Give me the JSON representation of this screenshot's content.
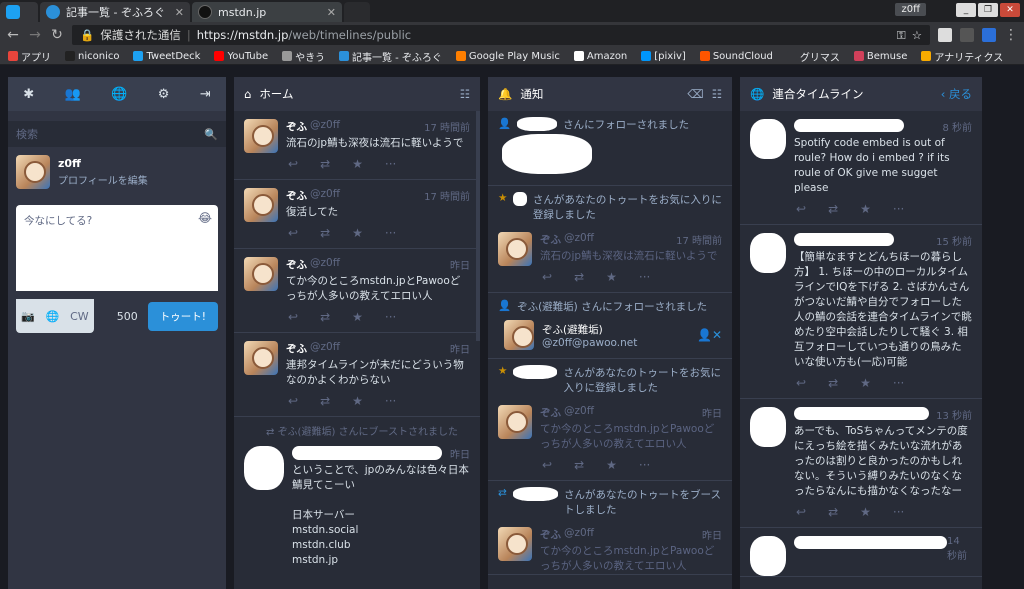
{
  "browser": {
    "tabs": [
      {
        "title": "",
        "icon": "twitter-icon"
      },
      {
        "title": "記事一覧 - ぞふろぐ",
        "icon": "blog-icon"
      },
      {
        "title": "mstdn.jp",
        "icon": "mastodon-icon"
      }
    ],
    "user_chip": "z0ff",
    "secure_label": "保護された通信",
    "url_host": "https://mstdn.jp",
    "url_path": "/web/timelines/public",
    "bookmarks": [
      {
        "label": "アプリ",
        "color": "#e8453c"
      },
      {
        "label": "niconico",
        "color": "#222222"
      },
      {
        "label": "TweetDeck",
        "color": "#1da1f2"
      },
      {
        "label": "YouTube",
        "color": "#ff0000"
      },
      {
        "label": "やきう",
        "color": "#999999"
      },
      {
        "label": "記事一覧 - ぞふろぐ",
        "color": "#2b90d9"
      },
      {
        "label": "Google Play Music",
        "color": "#ff7f00"
      },
      {
        "label": "Amazon",
        "color": "#ffffff"
      },
      {
        "label": "[pixiv]",
        "color": "#0096fa"
      },
      {
        "label": "SoundCloud",
        "color": "#ff5500"
      },
      {
        "label": "グリマス",
        "color": "#35363a"
      },
      {
        "label": "Bemuse",
        "color": "#d0405a"
      },
      {
        "label": "アナリティクス",
        "color": "#f9ab00"
      }
    ]
  },
  "compose": {
    "search_placeholder": "検索",
    "profile_name": "z0ff",
    "profile_edit": "プロフィールを編集",
    "textarea_placeholder": "今なにしてる?",
    "cw_label": "CW",
    "char_count": "500",
    "toot_label": "トゥート!"
  },
  "home": {
    "title": "ホーム",
    "statuses": [
      {
        "name": "ぞふ",
        "acct": "@z0ff",
        "time": "17 時間前",
        "text": "流石のjp鯖も深夜は流石に軽いようで"
      },
      {
        "name": "ぞふ",
        "acct": "@z0ff",
        "time": "17 時間前",
        "text": "復活してた"
      },
      {
        "name": "ぞふ",
        "acct": "@z0ff",
        "time": "昨日",
        "text": "てか今のところmstdn.jpとPawooどっちが人多いの教えてエロい人"
      },
      {
        "name": "ぞふ",
        "acct": "@z0ff",
        "time": "昨日",
        "text": "連邦タイムラインが未だにどういう物なのかよくわからない"
      }
    ],
    "boost_line": "ぞふ(避難垢) さんにブーストされました",
    "boost_time": "昨日",
    "boost_text": [
      "ということで、jpのみんなは色々日本鯖見てこーい",
      "",
      "日本サーバー",
      "mstdn.social",
      "mstdn.club",
      "mstdn.jp"
    ]
  },
  "notifications": {
    "title": "通知",
    "follow1": "さんにフォローされました",
    "fav1": "さんがあなたのトゥートをお気に入りに登録しました",
    "fav1_status": {
      "name": "ぞふ",
      "acct": "@z0ff",
      "time": "17 時間前",
      "text": "流石のjp鯖も深夜は流石に軽いようで"
    },
    "follow2": "ぞふ(避難垢) さんにフォローされました",
    "follow2_name": "ぞふ(避難垢)",
    "follow2_acct": "@z0ff@pawoo.net",
    "fav2": "さんがあなたのトゥートをお気に入りに登録しました",
    "fav2_status": {
      "name": "ぞふ",
      "acct": "@z0ff",
      "time": "昨日",
      "text": "てか今のところmstdn.jpとPawooどっちが人多いの教えてエロい人"
    },
    "boost": "さんがあなたのトゥートをブーストしました",
    "boost_status": {
      "name": "ぞふ",
      "acct": "@z0ff",
      "time": "昨日",
      "text": "てか今のところmstdn.jpとPawooどっちが人多いの教えてエロい人"
    }
  },
  "federated": {
    "title": "連合タイムライン",
    "back_label": "戻る",
    "statuses": [
      {
        "time": "8 秒前",
        "text": "Spotify code embed is out of roule? How do i embed ? if its roule of OK give me sugget please"
      },
      {
        "time": "15 秒前",
        "text": "【簡単なますとどんちほーの暮らし方】 1. ちほーの中のローカルタイムラインでIQを下げる 2. さばかんさんがつないだ鯖や自分でフォローした人の鯖の会話を連合タイムラインで眺めたり空中会話したりして騒ぐ 3. 相互フォローしていつも通りの鳥みたいな使い方も(一応)可能"
      },
      {
        "time": "13 秒前",
        "text": "あーでも、ToSちゃんってメンテの度にえっち絵を描くみたいな流れがあったのは割りと良かったのかもしれない。そういう縛りみたいのなくなったらなんにも描かなくなったなー"
      },
      {
        "time": "14 秒前",
        "text": ""
      }
    ]
  }
}
